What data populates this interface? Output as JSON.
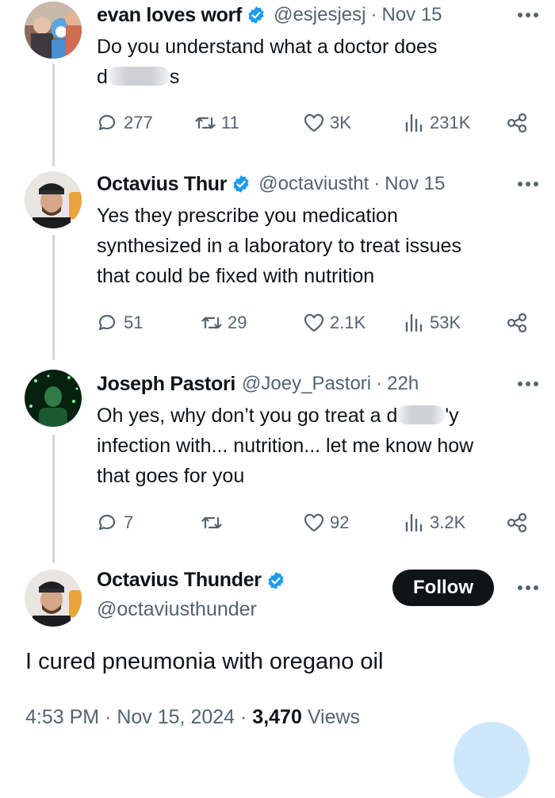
{
  "tweets": [
    {
      "name": "evan loves worf",
      "handle": "@esjesjesj",
      "time": "Nov 15",
      "text_line1": "Do you understand what a doctor does",
      "text_line2_start": "d",
      "text_line2_end": "s",
      "replies": "277",
      "retweets": "11",
      "likes": "3K",
      "views": "231K"
    },
    {
      "name": "Octavius Thur",
      "handle": "@octaviustht",
      "time": "Nov 15",
      "text_lines": [
        "Yes they prescribe you medication",
        "synthesized in a laboratory to treat issues",
        "that could be fixed with nutrition"
      ],
      "replies": "51",
      "retweets": "29",
      "likes": "2.1K",
      "views": "53K"
    },
    {
      "name": "Joseph Pastori",
      "handle": "@Joey_Pastori",
      "time": "22h",
      "text_line1_start": "Oh yes, why don’t you go treat a d",
      "text_line1_end": "'y",
      "text_lines_rest": [
        "infection with... nutrition... let me know how",
        "that goes for you"
      ],
      "replies": "7",
      "retweets": "",
      "likes": "92",
      "views": "3.2K"
    }
  ],
  "main_tweet": {
    "name": "Octavius Thunder",
    "handle": "@octaviusthunder",
    "follow_label": "Follow",
    "text": "I cured pneumonia with oregano oil",
    "time": "4:53 PM",
    "date": "Nov 15, 2024",
    "views_count": "3,470",
    "views_label": "Views"
  },
  "separator": "·",
  "colors": {
    "text": "#0f1419",
    "secondary": "#536471",
    "verified": "#1d9bf0",
    "thread_line": "#cfd9de"
  },
  "icons": [
    "verified-badge-icon",
    "more-icon",
    "reply-icon",
    "retweet-icon",
    "like-icon",
    "views-icon",
    "share-icon"
  ]
}
